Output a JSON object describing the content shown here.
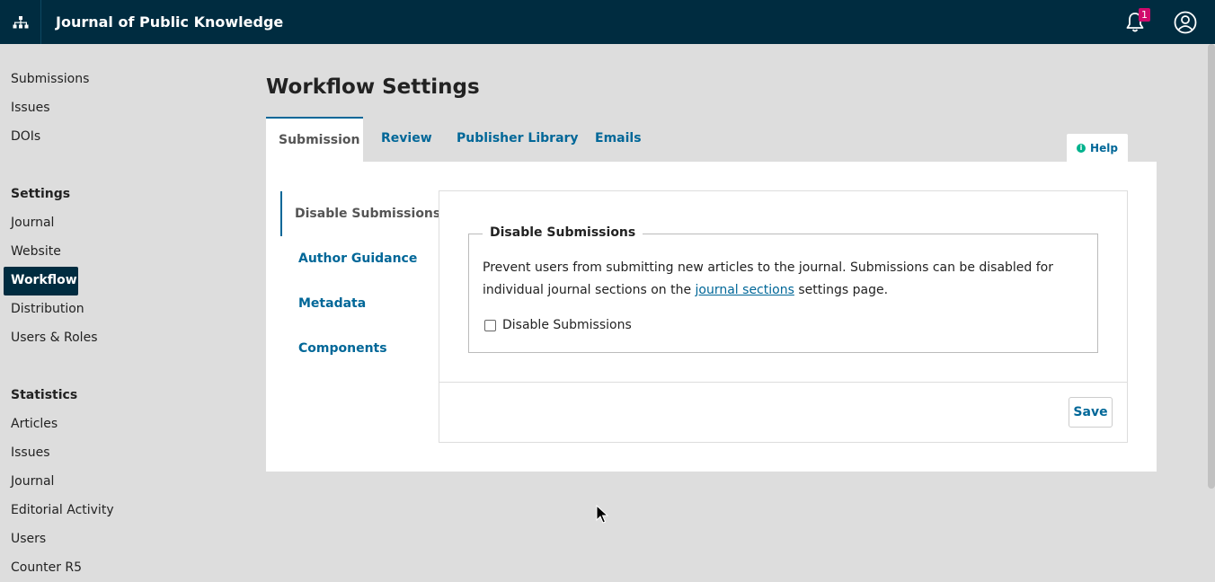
{
  "header": {
    "site_title": "Journal of Public Knowledge",
    "notification_count": "1",
    "icons": [
      "sitemap-icon",
      "bell-icon",
      "user-profile-icon"
    ]
  },
  "sidebar": {
    "top_items": [
      "Submissions",
      "Issues",
      "DOIs"
    ],
    "settings_heading": "Settings",
    "settings_items": [
      "Journal",
      "Website",
      "Workflow",
      "Distribution",
      "Users & Roles"
    ],
    "active_item": "Workflow",
    "statistics_heading": "Statistics",
    "statistics_items": [
      "Articles",
      "Issues",
      "Journal",
      "Editorial Activity",
      "Users",
      "Counter R5"
    ]
  },
  "page": {
    "title": "Workflow Settings",
    "tabs": [
      "Submission",
      "Review",
      "Publisher Library",
      "Emails"
    ],
    "active_tab": "Submission",
    "help_label": "Help"
  },
  "submission": {
    "side_tabs": [
      "Disable Submissions",
      "Author Guidance",
      "Metadata",
      "Components"
    ],
    "active_side_tab": "Disable Submissions",
    "fieldset_legend": "Disable Submissions",
    "description_before": "Prevent users from submitting new articles to the journal. Submissions can be disabled for individual journal sections on the",
    "description_link": "journal sections",
    "description_after": "settings page.",
    "checkbox_label": "Disable Submissions",
    "checkbox_checked": false,
    "save_label": "Save"
  },
  "colors": {
    "header_bg": "#002c40",
    "accent": "#006798",
    "badge": "#d00a6c",
    "help_icon": "#00b28d"
  }
}
